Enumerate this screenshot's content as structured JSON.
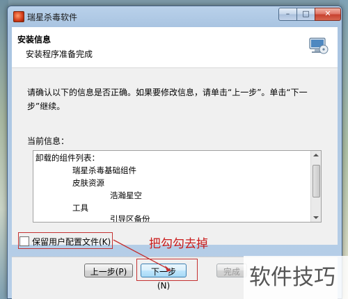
{
  "window": {
    "title": "瑞星杀毒软件",
    "controls": {
      "minimize": "–",
      "maximize": "□",
      "close": "✕"
    }
  },
  "header": {
    "title": "安装信息",
    "subtitle": "安装程序准备完成",
    "icon": "computer-cd-icon"
  },
  "body": {
    "description": "请确认以下的信息是否正确。如果要修改信息，请单击“上一步”。单击“下一步”继续。",
    "current_info_label": "当前信息：",
    "list_lines": [
      "卸载的组件列表：",
      "瑞星杀毒基础组件",
      "皮肤资源",
      "浩瀚星空",
      "工具",
      "引导区备份"
    ]
  },
  "checkbox": {
    "label": "保留用户配置文件(K)",
    "checked": false
  },
  "annotation": {
    "text": "把勾勾去掉",
    "color": "#c91a1a"
  },
  "buttons": {
    "prev": "上一步(P)",
    "next": "下一步(N)",
    "finish": "完成(F)"
  },
  "watermark": "软件技巧"
}
